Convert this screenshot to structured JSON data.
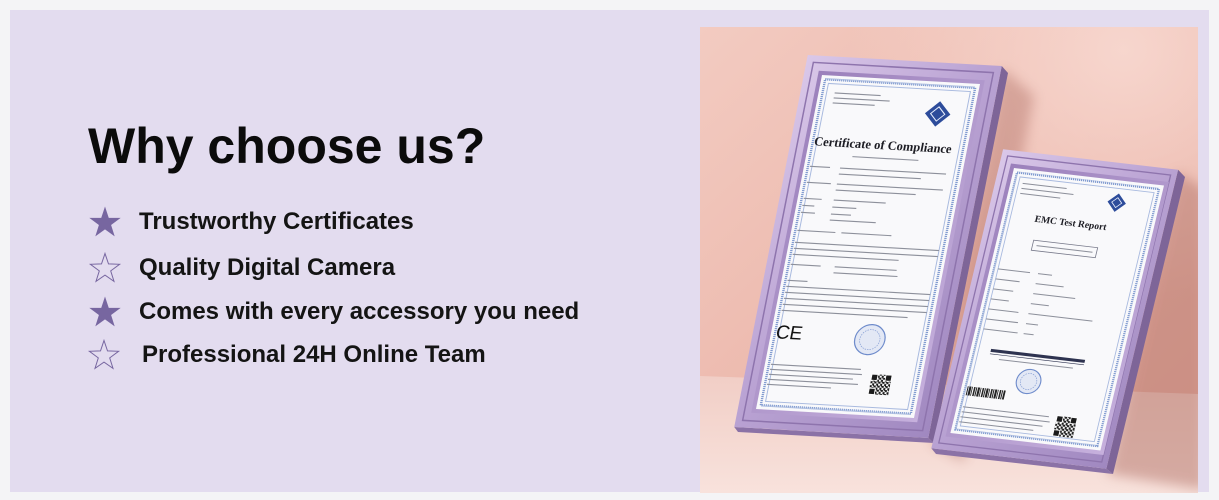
{
  "colors": {
    "page_border": "#f4f4f6",
    "panel_background": "#e3dcef",
    "star_accent": "#7766a0",
    "heading_text": "#0b0b0b",
    "frame_purple": "#bba4d4",
    "wall_pink": "#ebb6aa"
  },
  "heading": "Why choose us?",
  "features": [
    {
      "label": "Trustworthy Certificates",
      "icon": "star-filled-icon"
    },
    {
      "label": "Quality Digital Camera",
      "icon": "star-outline-icon"
    },
    {
      "label": "Comes with every accessory you need",
      "icon": "star-filled-icon"
    },
    {
      "label": "Professional 24H Online Team",
      "icon": "star-outline-icon"
    }
  ],
  "photo": {
    "certificate_left": {
      "title": "Certificate of Compliance",
      "mark": "CE"
    },
    "certificate_right": {
      "title": "EMC Test Report"
    }
  }
}
